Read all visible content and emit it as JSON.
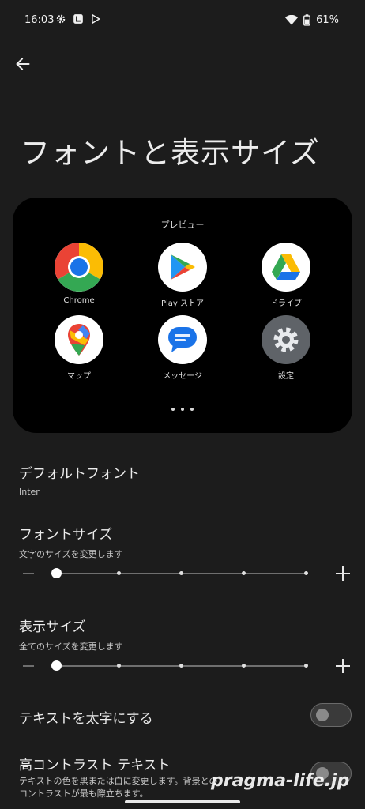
{
  "status": {
    "time": "16:03",
    "battery": "61%"
  },
  "page": {
    "title": "フォントと表示サイズ"
  },
  "preview": {
    "label": "プレビュー",
    "apps": [
      {
        "label": "Chrome",
        "icon": "chrome-icon"
      },
      {
        "label": "Play ストア",
        "icon": "play-store-icon"
      },
      {
        "label": "ドライブ",
        "icon": "drive-icon"
      },
      {
        "label": "マップ",
        "icon": "maps-icon"
      },
      {
        "label": "メッセージ",
        "icon": "messages-icon"
      },
      {
        "label": "設定",
        "icon": "settings-icon"
      }
    ]
  },
  "settings": {
    "default_font": {
      "title": "デフォルトフォント",
      "value": "Inter"
    },
    "font_size": {
      "title": "フォントサイズ",
      "subtitle": "文字のサイズを変更します",
      "level": 0,
      "steps": 4
    },
    "display_size": {
      "title": "表示サイズ",
      "subtitle": "全てのサイズを変更します",
      "level": 0,
      "steps": 4
    },
    "bold_text": {
      "title": "テキストを太字にする",
      "enabled": false
    },
    "high_contrast": {
      "title": "高コントラスト テキスト",
      "subtitle_line1": "テキストの色を黒または白に変更します。背景との",
      "subtitle_line2": "コントラストが最も際立ちます。",
      "enabled": false
    }
  },
  "watermark": "pragma-life.jp",
  "colors": {
    "background": "#1c1c1c",
    "card": "#000000",
    "accent": "#ffffff"
  }
}
